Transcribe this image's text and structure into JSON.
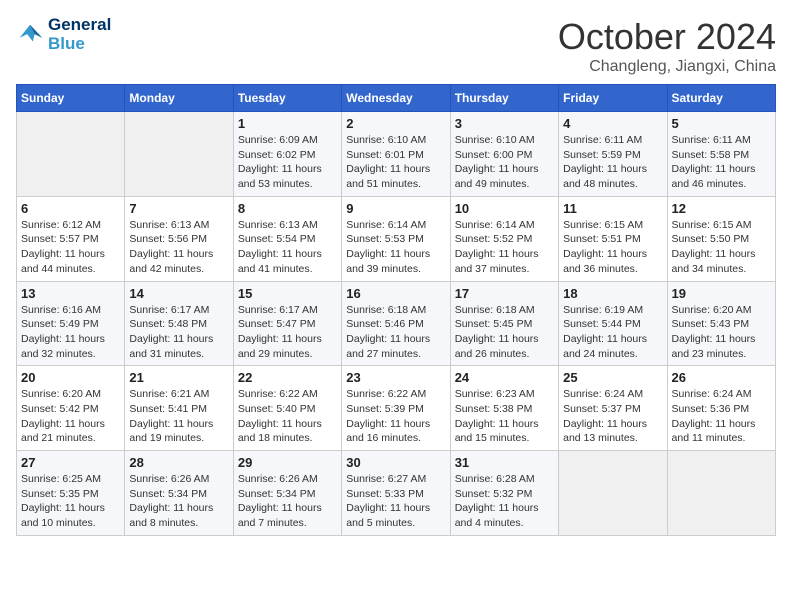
{
  "logo": {
    "line1": "General",
    "line2": "Blue"
  },
  "title": "October 2024",
  "location": "Changleng, Jiangxi, China",
  "days_header": [
    "Sunday",
    "Monday",
    "Tuesday",
    "Wednesday",
    "Thursday",
    "Friday",
    "Saturday"
  ],
  "weeks": [
    [
      {
        "day": "",
        "info": ""
      },
      {
        "day": "",
        "info": ""
      },
      {
        "day": "1",
        "info": "Sunrise: 6:09 AM\nSunset: 6:02 PM\nDaylight: 11 hours and 53 minutes."
      },
      {
        "day": "2",
        "info": "Sunrise: 6:10 AM\nSunset: 6:01 PM\nDaylight: 11 hours and 51 minutes."
      },
      {
        "day": "3",
        "info": "Sunrise: 6:10 AM\nSunset: 6:00 PM\nDaylight: 11 hours and 49 minutes."
      },
      {
        "day": "4",
        "info": "Sunrise: 6:11 AM\nSunset: 5:59 PM\nDaylight: 11 hours and 48 minutes."
      },
      {
        "day": "5",
        "info": "Sunrise: 6:11 AM\nSunset: 5:58 PM\nDaylight: 11 hours and 46 minutes."
      }
    ],
    [
      {
        "day": "6",
        "info": "Sunrise: 6:12 AM\nSunset: 5:57 PM\nDaylight: 11 hours and 44 minutes."
      },
      {
        "day": "7",
        "info": "Sunrise: 6:13 AM\nSunset: 5:56 PM\nDaylight: 11 hours and 42 minutes."
      },
      {
        "day": "8",
        "info": "Sunrise: 6:13 AM\nSunset: 5:54 PM\nDaylight: 11 hours and 41 minutes."
      },
      {
        "day": "9",
        "info": "Sunrise: 6:14 AM\nSunset: 5:53 PM\nDaylight: 11 hours and 39 minutes."
      },
      {
        "day": "10",
        "info": "Sunrise: 6:14 AM\nSunset: 5:52 PM\nDaylight: 11 hours and 37 minutes."
      },
      {
        "day": "11",
        "info": "Sunrise: 6:15 AM\nSunset: 5:51 PM\nDaylight: 11 hours and 36 minutes."
      },
      {
        "day": "12",
        "info": "Sunrise: 6:15 AM\nSunset: 5:50 PM\nDaylight: 11 hours and 34 minutes."
      }
    ],
    [
      {
        "day": "13",
        "info": "Sunrise: 6:16 AM\nSunset: 5:49 PM\nDaylight: 11 hours and 32 minutes."
      },
      {
        "day": "14",
        "info": "Sunrise: 6:17 AM\nSunset: 5:48 PM\nDaylight: 11 hours and 31 minutes."
      },
      {
        "day": "15",
        "info": "Sunrise: 6:17 AM\nSunset: 5:47 PM\nDaylight: 11 hours and 29 minutes."
      },
      {
        "day": "16",
        "info": "Sunrise: 6:18 AM\nSunset: 5:46 PM\nDaylight: 11 hours and 27 minutes."
      },
      {
        "day": "17",
        "info": "Sunrise: 6:18 AM\nSunset: 5:45 PM\nDaylight: 11 hours and 26 minutes."
      },
      {
        "day": "18",
        "info": "Sunrise: 6:19 AM\nSunset: 5:44 PM\nDaylight: 11 hours and 24 minutes."
      },
      {
        "day": "19",
        "info": "Sunrise: 6:20 AM\nSunset: 5:43 PM\nDaylight: 11 hours and 23 minutes."
      }
    ],
    [
      {
        "day": "20",
        "info": "Sunrise: 6:20 AM\nSunset: 5:42 PM\nDaylight: 11 hours and 21 minutes."
      },
      {
        "day": "21",
        "info": "Sunrise: 6:21 AM\nSunset: 5:41 PM\nDaylight: 11 hours and 19 minutes."
      },
      {
        "day": "22",
        "info": "Sunrise: 6:22 AM\nSunset: 5:40 PM\nDaylight: 11 hours and 18 minutes."
      },
      {
        "day": "23",
        "info": "Sunrise: 6:22 AM\nSunset: 5:39 PM\nDaylight: 11 hours and 16 minutes."
      },
      {
        "day": "24",
        "info": "Sunrise: 6:23 AM\nSunset: 5:38 PM\nDaylight: 11 hours and 15 minutes."
      },
      {
        "day": "25",
        "info": "Sunrise: 6:24 AM\nSunset: 5:37 PM\nDaylight: 11 hours and 13 minutes."
      },
      {
        "day": "26",
        "info": "Sunrise: 6:24 AM\nSunset: 5:36 PM\nDaylight: 11 hours and 11 minutes."
      }
    ],
    [
      {
        "day": "27",
        "info": "Sunrise: 6:25 AM\nSunset: 5:35 PM\nDaylight: 11 hours and 10 minutes."
      },
      {
        "day": "28",
        "info": "Sunrise: 6:26 AM\nSunset: 5:34 PM\nDaylight: 11 hours and 8 minutes."
      },
      {
        "day": "29",
        "info": "Sunrise: 6:26 AM\nSunset: 5:34 PM\nDaylight: 11 hours and 7 minutes."
      },
      {
        "day": "30",
        "info": "Sunrise: 6:27 AM\nSunset: 5:33 PM\nDaylight: 11 hours and 5 minutes."
      },
      {
        "day": "31",
        "info": "Sunrise: 6:28 AM\nSunset: 5:32 PM\nDaylight: 11 hours and 4 minutes."
      },
      {
        "day": "",
        "info": ""
      },
      {
        "day": "",
        "info": ""
      }
    ]
  ]
}
